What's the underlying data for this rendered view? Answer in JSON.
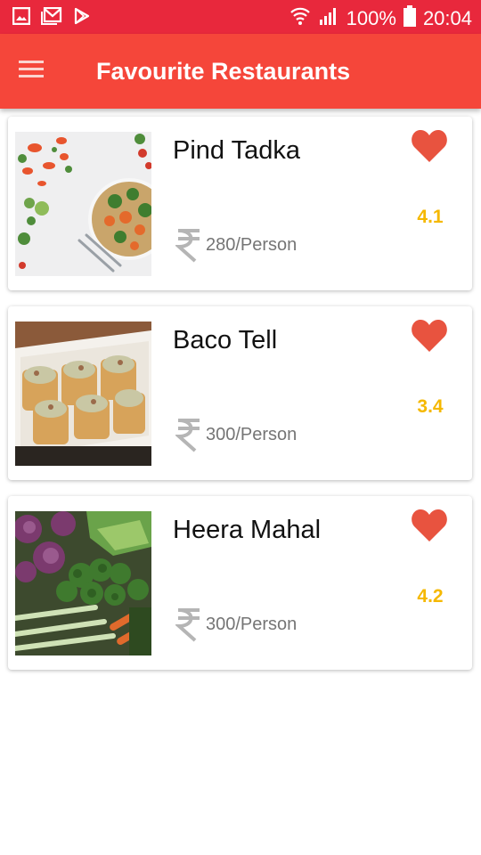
{
  "status_bar": {
    "left_icons": [
      "gallery-icon",
      "gmail-icon",
      "play-store-icon"
    ],
    "wifi_icon": "wifi-icon",
    "signal_icon": "signal-icon",
    "battery_percent": "100%",
    "battery_icon": "battery-icon",
    "time": "20:04",
    "background": "#e8283c"
  },
  "app_bar": {
    "menu_icon": "hamburger-menu-icon",
    "title": "Favourite Restaurants",
    "background": "#f5463a"
  },
  "restaurants": [
    {
      "name": "Pind Tadka",
      "rating": "4.1",
      "price": "280/Person",
      "favorite": true,
      "image_icon": "food-photo-salad"
    },
    {
      "name": "Baco Tell",
      "rating": "3.4",
      "price": "300/Person",
      "favorite": true,
      "image_icon": "food-photo-tacos"
    },
    {
      "name": "Heera Mahal",
      "rating": "4.2",
      "price": "300/Person",
      "favorite": true,
      "image_icon": "food-photo-vegetables"
    }
  ],
  "colors": {
    "heart": "#e8533f",
    "rating": "#f5b800",
    "price_text": "#757575"
  }
}
